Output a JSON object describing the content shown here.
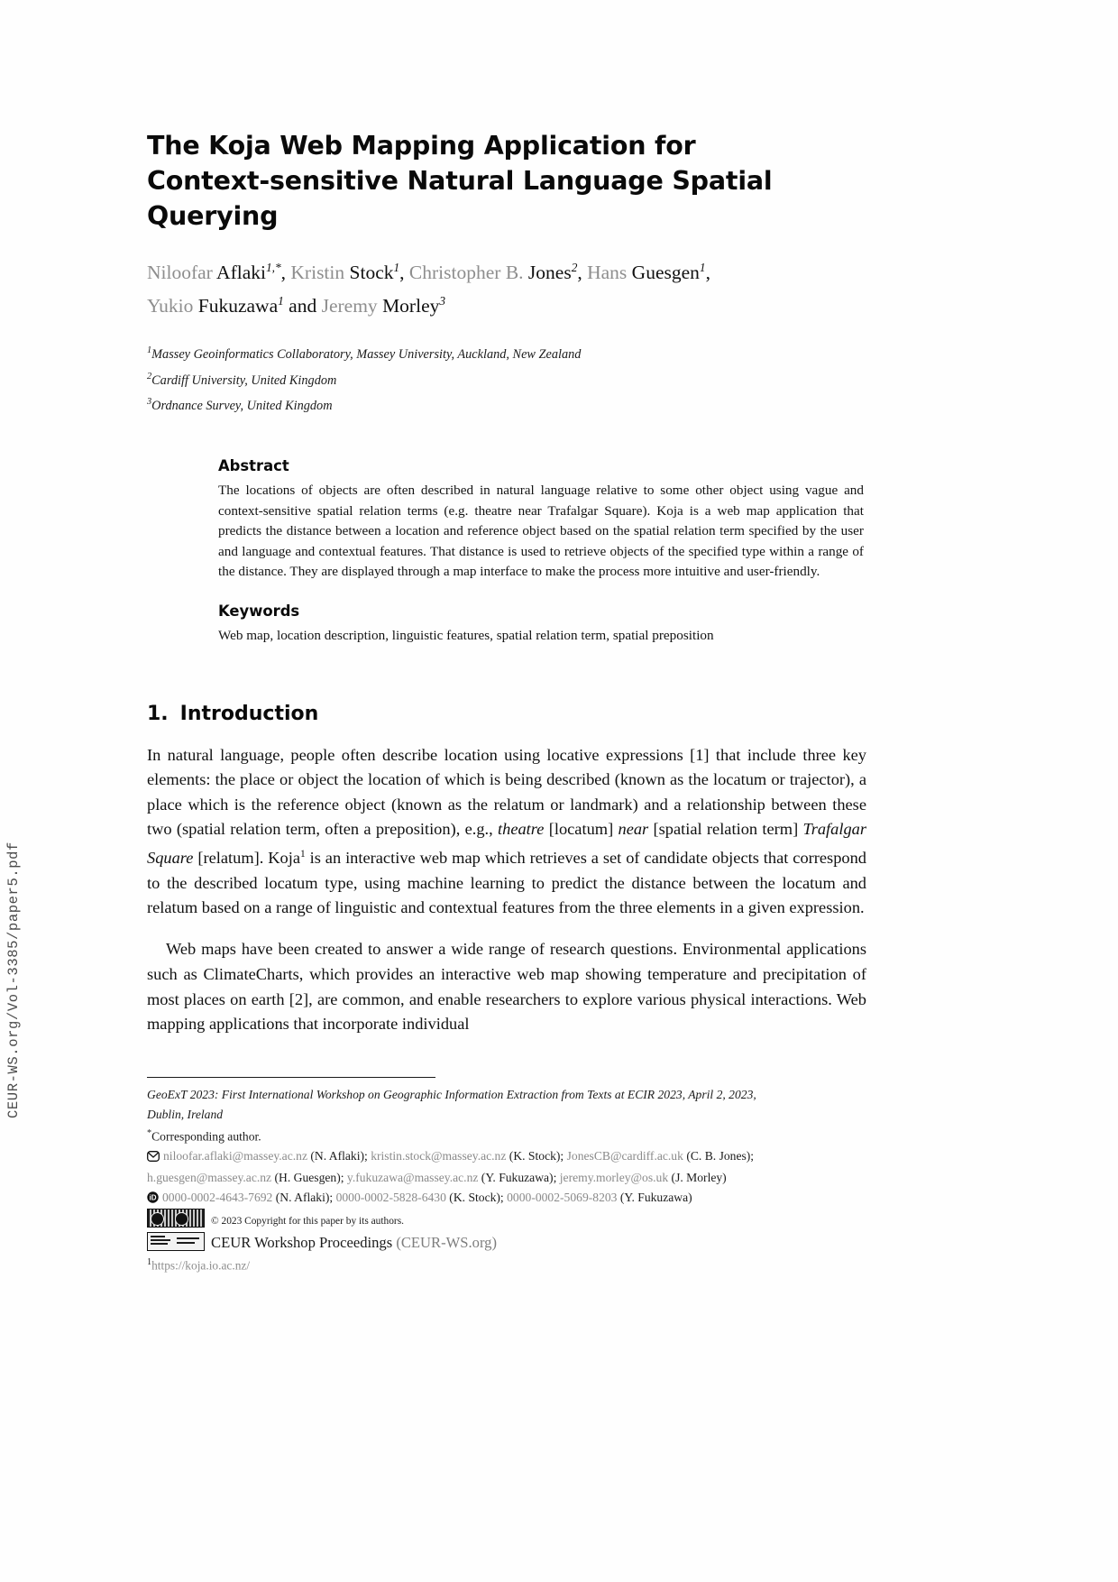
{
  "spine": {
    "text": "CEUR-WS.org/Vol-3385/paper5.pdf"
  },
  "paper": {
    "title_line1": "The Koja Web Mapping Application for",
    "title_line2": "Context-sensitive Natural Language Spatial Querying",
    "authors": [
      {
        "first": "Niloofar",
        "last": "Aflaki",
        "sup": "1,*"
      },
      {
        "first": "Kristin",
        "last": "Stock",
        "sup": "1"
      },
      {
        "first": "Christopher B.",
        "last": "Jones",
        "sup": "2"
      },
      {
        "first": "Hans",
        "last": "Guesgen",
        "sup": "1"
      },
      {
        "first": "Yukio",
        "last": "Fukuzawa",
        "sup": "1"
      },
      {
        "first": "Jeremy",
        "last": "Morley",
        "sup": "3"
      }
    ],
    "authors_conjunction": "and",
    "affiliations": [
      {
        "marker": "1",
        "text": "Massey Geoinformatics Collaboratory, Massey University, Auckland, New Zealand"
      },
      {
        "marker": "2",
        "text": "Cardiff University, United Kingdom"
      },
      {
        "marker": "3",
        "text": "Ordnance Survey, United Kingdom"
      }
    ]
  },
  "abstract": {
    "heading": "Abstract",
    "body": "The locations of objects are often described in natural language relative to some other object using vague and context-sensitive spatial relation terms (e.g. theatre near Trafalgar Square). Koja is a web map application that predicts the distance between a location and reference object based on the spatial relation term specified by the user and language and contextual features. That distance is used to retrieve objects of the specified type within a range of the distance. They are displayed through a map interface to make the process more intuitive and user-friendly."
  },
  "keywords": {
    "heading": "Keywords",
    "body": "Web map, location description, linguistic features, spatial relation term, spatial preposition"
  },
  "section": {
    "number": "1.",
    "title": "Introduction",
    "paragraph1_a": "In natural language, people often describe location using locative expressions [1] that include three key elements: the place or object the location of which is being described (known as the locatum or trajector), a place which is the reference object (known as the relatum or landmark) and a relationship between these two (spatial relation term, often a preposition), e.g., ",
    "paragraph1_italic1": "theatre",
    "paragraph1_b": " [locatum] ",
    "paragraph1_italic2": "near",
    "paragraph1_c": " [spatial relation term] ",
    "paragraph1_italic3": "Trafalgar Square",
    "paragraph1_d": " [relatum]. Koja",
    "paragraph1_footnote_marker": "1",
    "paragraph1_e": " is an interactive web map which retrieves a set of candidate objects that correspond to the described locatum type, using machine learning to predict the distance between the locatum and relatum based on a range of linguistic and contextual features from the three elements in a given expression.",
    "paragraph2": "Web maps have been created to answer a wide range of research questions. Environmental applications such as ClimateCharts, which provides an interactive web map showing temperature and precipitation of most places on earth [2], are common, and enable researchers to explore various physical interactions. Web mapping applications that incorporate individual"
  },
  "footnotes": {
    "venue_line1": "GeoExT 2023: First International Workshop on Geographic Information Extraction from Texts at ECIR 2023, April 2, 2023,",
    "venue_line2": "Dublin, Ireland",
    "corresponding_marker": "*",
    "corresponding": "Corresponding author.",
    "email_icon": "envelope-icon",
    "emails_line1_a": "niloofar.aflaki@massey.ac.nz",
    "emails_line1_b": " (N. Aflaki); ",
    "emails_line1_c": "kristin.stock@massey.ac.nz",
    "emails_line1_d": " (K. Stock); ",
    "emails_line1_e": "JonesCB@cardiff.ac.uk",
    "emails_line2_a": "(C. B. Jones); ",
    "emails_line2_b": "h.guesgen@massey.ac.nz",
    "emails_line2_c": " (H. Guesgen); ",
    "emails_line2_d": "y.fukuzawa@massey.ac.nz",
    "emails_line2_e": " (Y. Fukuzawa);",
    "emails_line3_a": "jeremy.morley@os.uk",
    "emails_line3_b": " (J. Morley)",
    "orcid_icon": "orcid-icon",
    "orcid_1": "0000-0002-4643-7692",
    "orcid_1_name": " (N. Aflaki); ",
    "orcid_2": "0000-0002-5828-6430",
    "orcid_2_name": " (K. Stock); ",
    "orcid_3": "0000-0002-5069-8203",
    "orcid_3_name": " (Y. Fukuzawa)",
    "cc_badge": "creative-commons-badge",
    "copyright": "© 2023 Copyright for this paper by its authors.",
    "ceur_badge": "ceur-ws-logo",
    "ceur_text_a": "CEUR Workshop Proceedings ",
    "ceur_text_b": "(CEUR-WS.org)",
    "footnote_marker": "1",
    "footnote_url": "https://koja.io.ac.nz/"
  }
}
